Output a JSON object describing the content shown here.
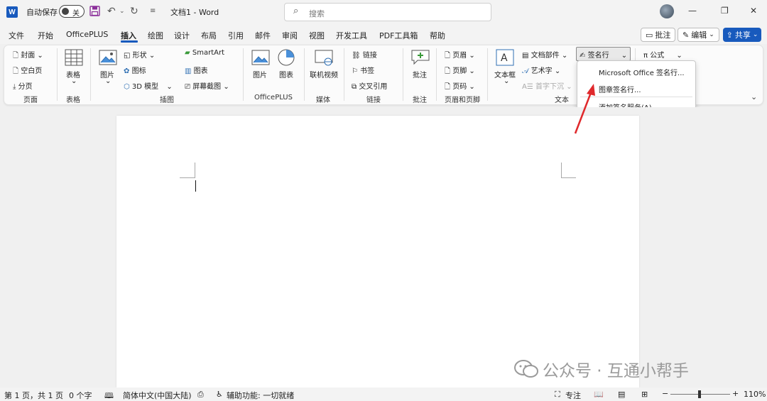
{
  "titlebar": {
    "app_icon": "W",
    "autosave_label": "自动保存",
    "autosave_toggle": "关",
    "doc_title": "文档1  -  Word",
    "search_placeholder": "搜索"
  },
  "tabs": [
    "文件",
    "开始",
    "OfficePLUS",
    "插入",
    "绘图",
    "设计",
    "布局",
    "引用",
    "邮件",
    "审阅",
    "视图",
    "开发工具",
    "PDF工具箱",
    "帮助"
  ],
  "active_tab": "插入",
  "right_buttons": {
    "comment": "批注",
    "edit": "编辑",
    "share": "共享"
  },
  "ribbon": {
    "pages": {
      "items": [
        "封面",
        "空白页",
        "分页"
      ],
      "label": "页面"
    },
    "tables": {
      "item": "表格",
      "label": "表格"
    },
    "illustrations": {
      "picture": "图片",
      "shapes": "形状",
      "icons": "图标",
      "model3d": "3D 模型",
      "smartart": "SmartArt",
      "chart": "图表",
      "screenshot": "屏幕截图",
      "label": "插图"
    },
    "officeplus": {
      "picture": "图片",
      "chart": "图表",
      "label": "OfficePLUS"
    },
    "media": {
      "video": "联机视频",
      "label": "媒体"
    },
    "links": {
      "link": "链接",
      "bookmark": "书签",
      "crossref": "交叉引用",
      "label": "链接"
    },
    "comments": {
      "comment": "批注",
      "label": "批注"
    },
    "header_footer": {
      "header": "页眉",
      "footer": "页脚",
      "page_number": "页码",
      "label": "页眉和页脚"
    },
    "text": {
      "textbox": "文本框",
      "quickparts": "文档部件",
      "wordart": "艺术字",
      "dropcap": "首字下沉",
      "signature": "签名行",
      "label": "文本"
    },
    "symbols": {
      "equation": "公式"
    }
  },
  "signature_menu": {
    "items": [
      "Microsoft Office 签名行...",
      "图章签名行...",
      "添加签名服务(A)..."
    ]
  },
  "watermark": {
    "text": "公众号 · 互通小帮手"
  },
  "statusbar": {
    "page": "第 1 页，共 1 页",
    "words": "0 个字",
    "language": "简体中文(中国大陆)",
    "accessibility": "辅助功能: 一切就绪",
    "focus": "专注",
    "zoom": "110%"
  },
  "colors": {
    "accent": "#185abd",
    "arrow": "#e0292c"
  }
}
